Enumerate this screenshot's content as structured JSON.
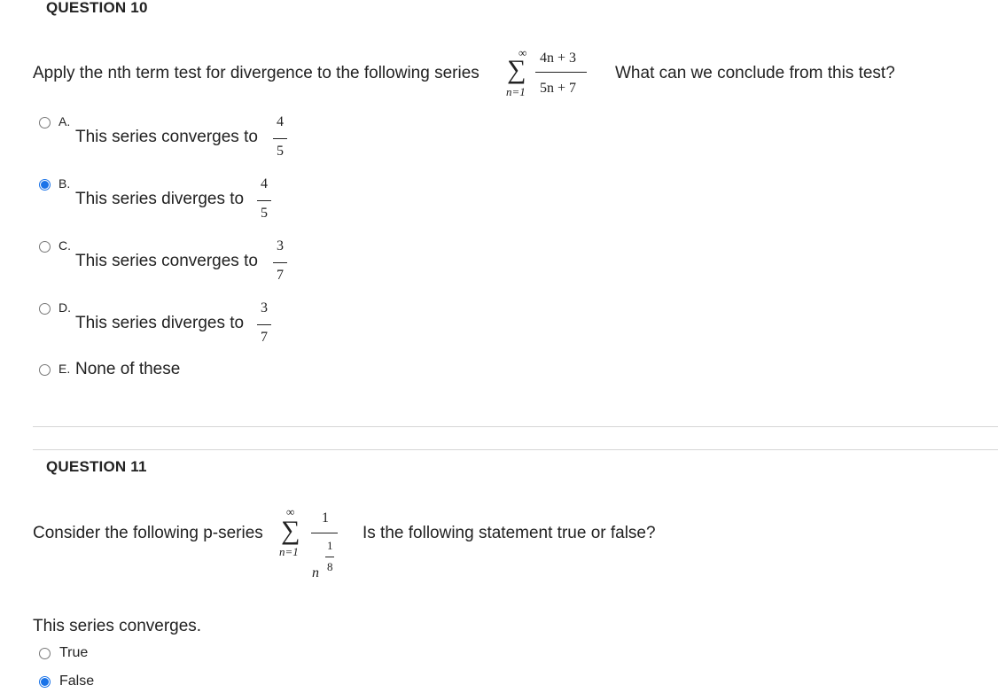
{
  "q10": {
    "title": "QUESTION 10",
    "prompt_before": "Apply the nth term test for divergence to the following series",
    "prompt_after": "What can we conclude from this test?",
    "series": {
      "sigma": "∑",
      "upper": "∞",
      "lower": "n=1",
      "numerator": "4n + 3",
      "denominator": "5n + 7"
    },
    "choices": [
      {
        "letter": "A.",
        "text": "This series converges to",
        "num": "4",
        "den": "5",
        "selected": false
      },
      {
        "letter": "B.",
        "text": "This series diverges to",
        "num": "4",
        "den": "5",
        "selected": true
      },
      {
        "letter": "C.",
        "text": "This series converges to",
        "num": "3",
        "den": "7",
        "selected": false
      },
      {
        "letter": "D.",
        "text": "This series diverges to",
        "num": "3",
        "den": "7",
        "selected": false
      },
      {
        "letter": "E.",
        "text": "None of these",
        "selected": false
      }
    ]
  },
  "q11": {
    "title": "QUESTION 11",
    "prompt_before": "Consider the following p-series",
    "prompt_after": "Is the following statement true or false?",
    "series": {
      "sigma": "∑",
      "upper": "∞",
      "lower": "n=1",
      "numerator": "1",
      "base": "n",
      "exp_num": "1",
      "exp_den": "8"
    },
    "statement": "This series converges.",
    "options": [
      {
        "label": "True",
        "selected": false
      },
      {
        "label": "False",
        "selected": true
      }
    ]
  }
}
